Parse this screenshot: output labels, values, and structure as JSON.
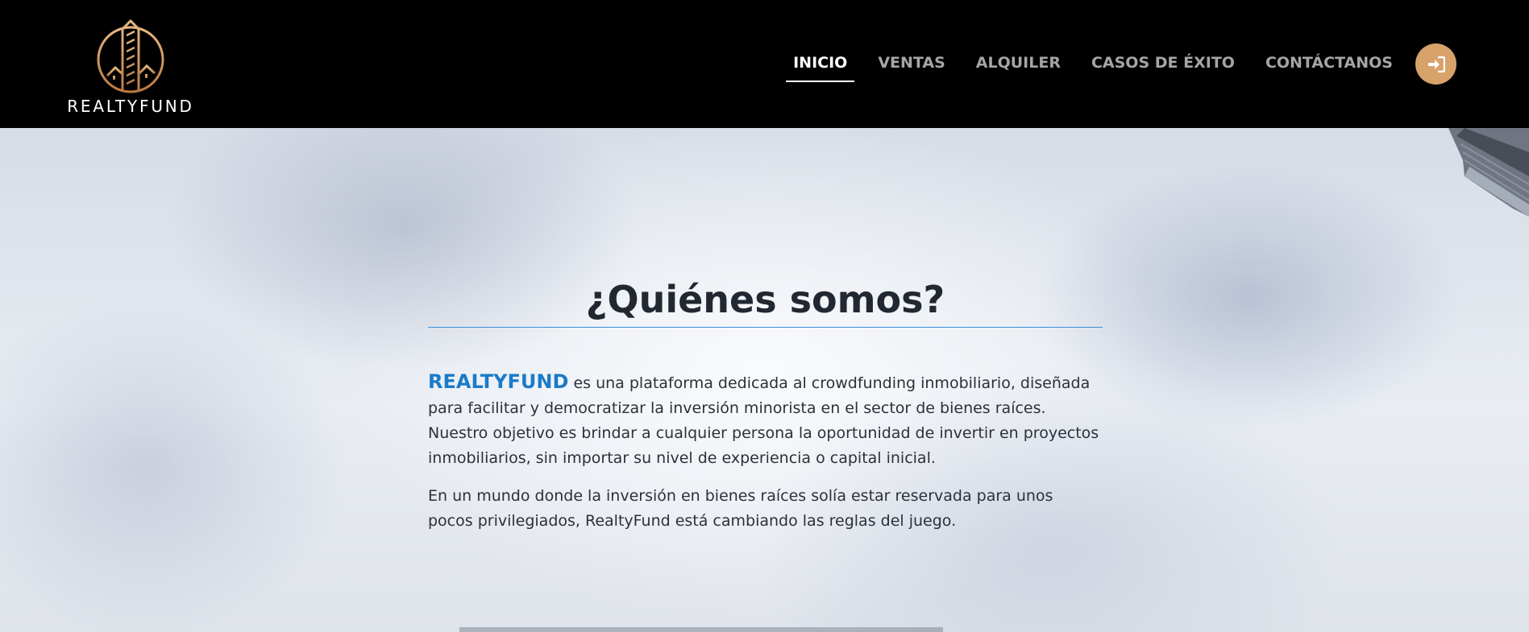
{
  "brand": {
    "name": "REALTYFUND",
    "accent_color": "#d8a26b"
  },
  "nav": {
    "items": [
      {
        "label": "INICIO",
        "active": true
      },
      {
        "label": "VENTAS",
        "active": false
      },
      {
        "label": "ALQUILER",
        "active": false
      },
      {
        "label": "CASOS DE ÉXITO",
        "active": false
      },
      {
        "label": "CONTÁCTANOS",
        "active": false
      }
    ],
    "login_icon": "sign-in-icon"
  },
  "about": {
    "title": "¿Quiénes somos?",
    "highlight": "REALTYFUND",
    "paragraph1": " es una plataforma dedicada al crowdfunding inmobiliario, diseñada para facilitar y democratizar la inversión minorista en el sector de bienes raíces. Nuestro objetivo es brindar a cualquier persona la oportunidad de invertir en proyectos inmobiliarios, sin importar su nivel de experiencia o capital inicial.",
    "paragraph2": "En un mundo donde la inversión en bienes raíces solía estar reservada para unos pocos privilegiados, RealtyFund está cambiando las reglas del juego.",
    "highlight_color": "#1a7bc8",
    "rule_color": "#3b8fdc"
  }
}
